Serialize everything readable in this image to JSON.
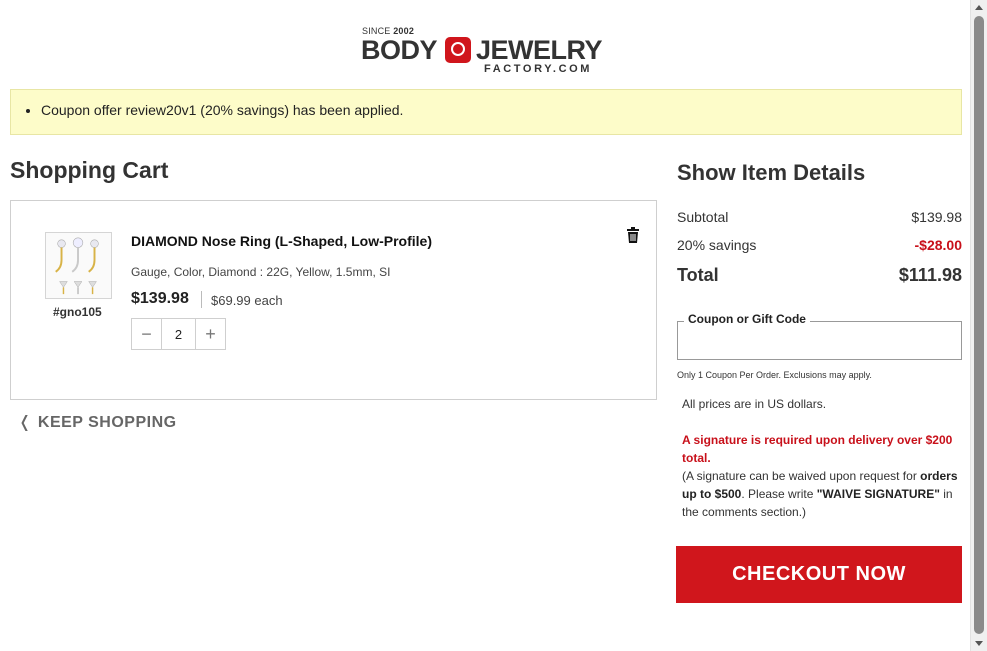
{
  "logo": {
    "since_prefix": "SINCE",
    "since_year": "2002",
    "word1": "BODY",
    "word2": "JEWELRY",
    "sub": "FACTORY.COM"
  },
  "notice": {
    "message": "Coupon offer review20v1 (20% savings) has been applied."
  },
  "cart": {
    "title": "Shopping Cart",
    "items": [
      {
        "sku": "#gno105",
        "name": "DIAMOND Nose Ring (L-Shaped, Low-Profile)",
        "options": "Gauge, Color, Diamond : 22G, Yellow, 1.5mm, SI",
        "price": "$139.98",
        "each": "$69.99 each",
        "quantity": "2",
        "decrease_label": "−",
        "increase_label": "+"
      }
    ],
    "keep_shopping": "KEEP SHOPPING"
  },
  "summary": {
    "title": "Show Item Details",
    "subtotal_label": "Subtotal",
    "subtotal_value": "$139.98",
    "savings_label": "20% savings",
    "savings_value": "-$28.00",
    "total_label": "Total",
    "total_value": "$111.98",
    "coupon_label": "Coupon or Gift Code",
    "coupon_value": "",
    "coupon_note": "Only 1 Coupon Per Order. Exclusions may apply.",
    "usd_note": "All prices are in US dollars.",
    "signature_warning": "A signature is required upon delivery over $200 total.",
    "signature_open": "(A signature can be waived upon request for ",
    "signature_bold1": "orders up to $500",
    "signature_mid": ". Please write ",
    "signature_bold2": "\"WAIVE SIGNATURE\"",
    "signature_end": " in the comments section.)",
    "checkout_label": "CHECKOUT NOW"
  },
  "colors": {
    "brand_red": "#d0161c",
    "notice_bg": "#fdfcc9",
    "savings_red": "#c8101a"
  },
  "icons": {
    "trash": "trash-icon",
    "chevron": "chevron-left-icon"
  }
}
